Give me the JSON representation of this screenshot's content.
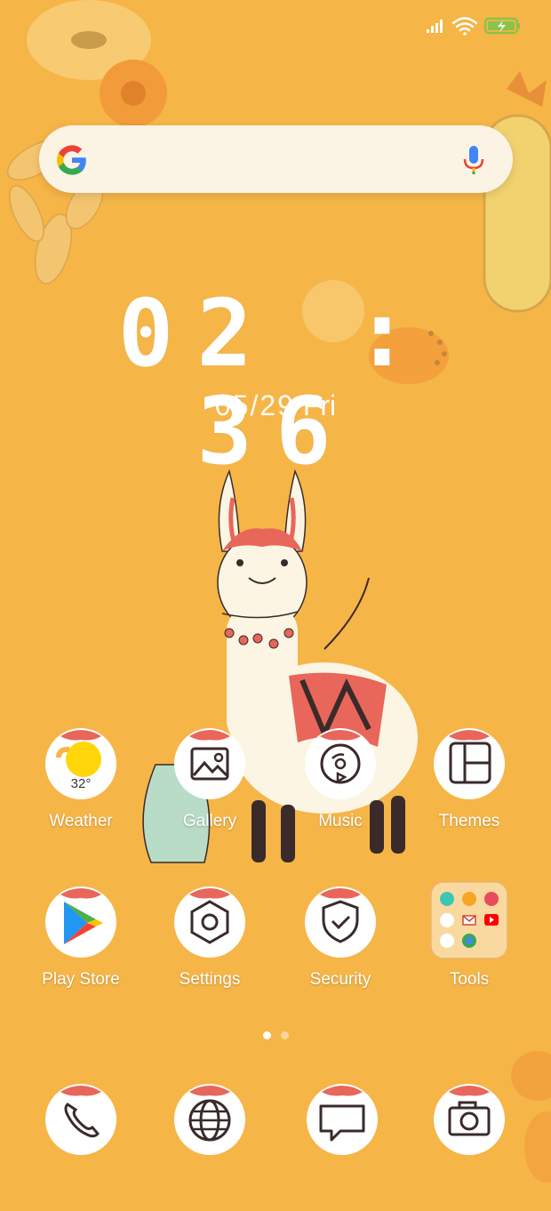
{
  "status_bar": {
    "signal_icon": "signal-icon",
    "wifi_icon": "wifi-icon",
    "battery_icon": "battery-charging-icon",
    "battery_color": "#8BC34A"
  },
  "search_bar": {
    "logo": "google-g-icon",
    "mic": "microphone-icon"
  },
  "clock": {
    "time": "02 : 36",
    "date_numeric": "05/29",
    "weekday": "Fri"
  },
  "apps_row1": [
    {
      "label": "Weather",
      "icon": "weather-sun-icon",
      "temp": "32°"
    },
    {
      "label": "Gallery",
      "icon": "gallery-image-icon"
    },
    {
      "label": "Music",
      "icon": "music-disc-icon"
    },
    {
      "label": "Themes",
      "icon": "themes-icon"
    }
  ],
  "apps_row2": [
    {
      "label": "Play Store",
      "icon": "play-store-icon"
    },
    {
      "label": "Settings",
      "icon": "settings-hexagon-icon"
    },
    {
      "label": "Security",
      "icon": "security-shield-icon"
    },
    {
      "label": "Tools",
      "icon": "tools-folder-icon"
    }
  ],
  "page_indicator": {
    "pages": 2,
    "current": 1
  },
  "dock": [
    {
      "icon": "phone-icon"
    },
    {
      "icon": "browser-globe-icon"
    },
    {
      "icon": "messages-icon"
    },
    {
      "icon": "camera-icon"
    }
  ],
  "colors": {
    "background": "#F6B547",
    "flower": "#F29B3B",
    "accent_red": "#E8665A",
    "icon_outline": "#3A2A2A"
  }
}
